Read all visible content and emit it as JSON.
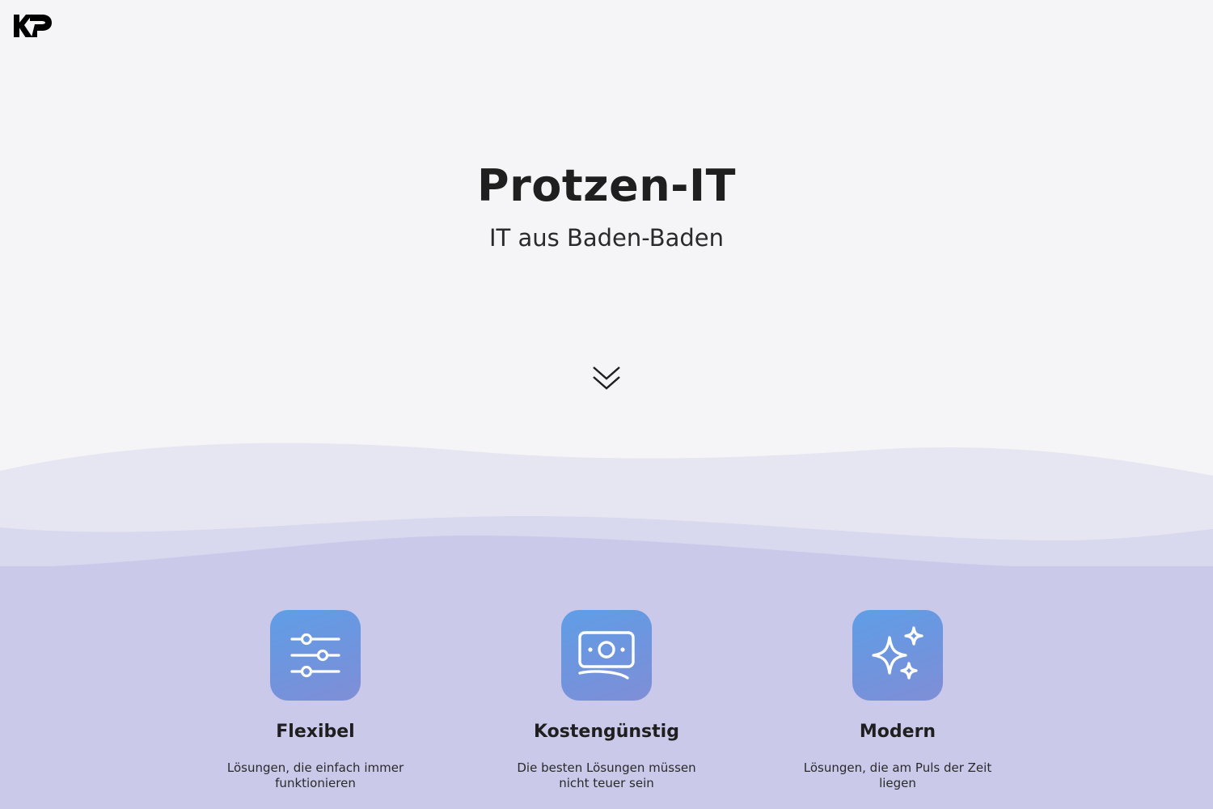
{
  "header": {
    "logo_icon": "kp-logo-icon"
  },
  "hero": {
    "title": "Protzen-IT",
    "subtitle": "IT aus Baden-Baden",
    "scroll_icon": "double-chevron-down-icon"
  },
  "colors": {
    "background": "#f5f5f7",
    "wave_light": "#e6e6f2",
    "wave_mid": "#d8d8ee",
    "band": "#cac9ea",
    "icon_gradient_start": "#5f9ee6",
    "icon_gradient_end": "#7f8ed6"
  },
  "features": [
    {
      "icon": "sliders-icon",
      "title": "Flexibel",
      "text": "Lösungen, die einfach immer funktionieren"
    },
    {
      "icon": "banknote-icon",
      "title": "Kostengünstig",
      "text": "Die besten Lösungen müssen nicht teuer sein"
    },
    {
      "icon": "sparkles-icon",
      "title": "Modern",
      "text": "Lösungen, die am Puls der Zeit liegen"
    }
  ]
}
